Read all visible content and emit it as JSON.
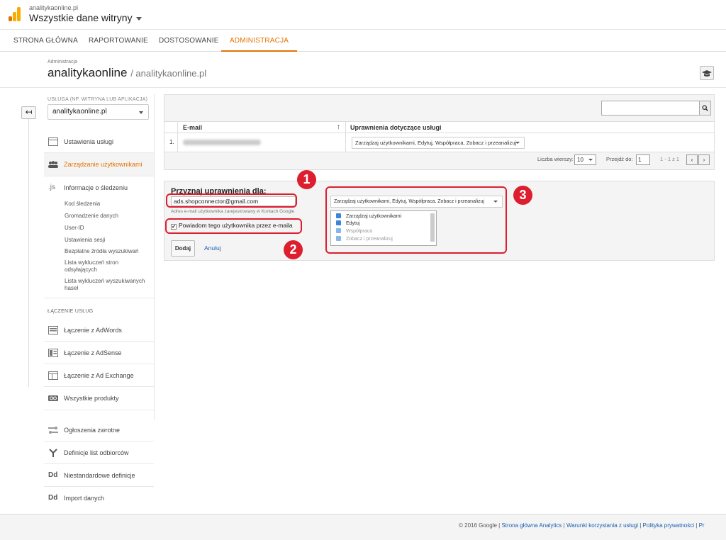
{
  "account": {
    "domain": "analitykaonline.pl",
    "view": "Wszystkie dane witryny"
  },
  "nav": [
    "STRONA GŁÓWNA",
    "RAPORTOWANIE",
    "DOSTOSOWANIE",
    "ADMINISTRACJA"
  ],
  "admin": {
    "breadcrumb": "Administracja",
    "title": "analitykaonline",
    "subtitle": "/ analitykaonline.pl"
  },
  "sidebar": {
    "service_label": "USŁUGA (NP. WITRYNA LUB APLIKACJA)",
    "service_value": "analitykaonline.pl",
    "items": [
      "Ustawienia usługi",
      "Zarządzanie użytkownikami",
      "Informacje o śledzeniu"
    ],
    "tracking_prefix": ".js",
    "sub_items": [
      "Kod śledzenia",
      "Gromadzenie danych",
      "User-ID",
      "Ustawienia sesji",
      "Bezpłatne źródła wyszukiwań",
      "Lista wykluczeń stron odsyłających",
      "Lista wykluczeń wyszukiwanych haseł"
    ],
    "links_heading": "ŁĄCZENIE USŁUG",
    "link_items": [
      "Łączenie z AdWords",
      "Łączenie z AdSense",
      "Łączenie z Ad Exchange",
      "Wszystkie produkty"
    ],
    "other_items": [
      "Ogłoszenia zwrotne",
      "Definicje list odbiorców",
      "Niestandardowe definicje",
      "Import danych"
    ],
    "dd_label": "Dd"
  },
  "table": {
    "columns": [
      "E-mail",
      "Uprawnienia dotyczące usługi"
    ],
    "rows": [
      {
        "index": "1.",
        "permissions": "Zarządzaj użytkownikami, Edytuj, Współpraca, Zobacz i przeanalizuj"
      }
    ],
    "rows_label": "Liczba wierszy:",
    "rows_value": "10",
    "goto_label": "Przejdź do:",
    "goto_value": "1",
    "range": "1 - 1 z 1"
  },
  "grant": {
    "title": "Przyznaj uprawnienia dla:",
    "email_value": "ads.shopconnector@gmail.com",
    "hint": "Adres e-mail użytkownika zarejestrowany w Kontach Google",
    "notify_label": "Powiadom tego użytkownika przez e-maila",
    "add_label": "Dodaj",
    "cancel_label": "Anuluj",
    "perm_select": "Zarządzaj użytkownikami, Edytuj, Współpraca, Zobacz i przeanalizuj",
    "perm_options": [
      "Zarządzaj użytkownikami",
      "Edytuj",
      "Współpraca",
      "Zobacz i przeanalizuj"
    ]
  },
  "annotations": [
    "1",
    "2",
    "3"
  ],
  "footer": {
    "copyright": "© 2016 Google",
    "links": [
      "Strona główna Analytics",
      "Warunki korzystania z usługi",
      "Polityka prywatności",
      "Pr"
    ]
  },
  "colors": {
    "accent": "#e37400",
    "annotation": "#dd1e2f",
    "link": "#1a5fb4",
    "checkbox": "#3b86d6"
  }
}
